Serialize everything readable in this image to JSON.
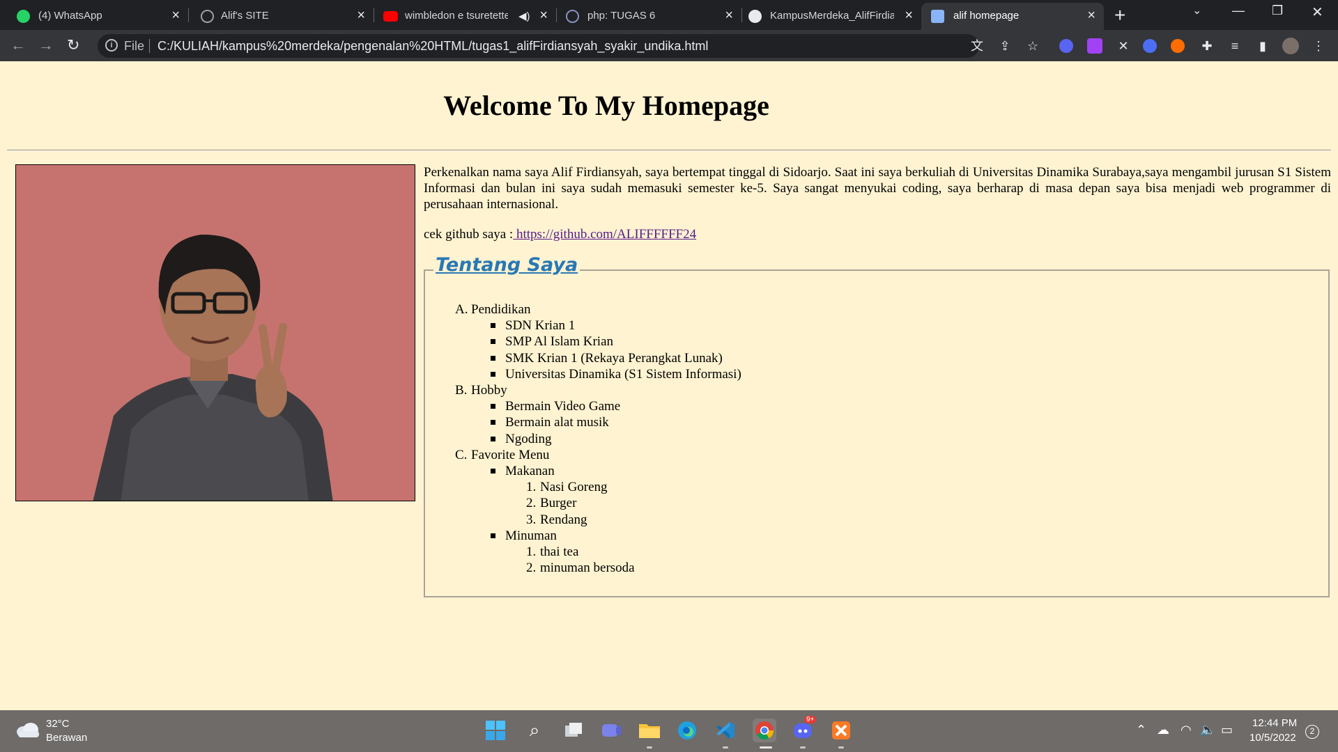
{
  "browser": {
    "tabs": [
      {
        "title": "(4) WhatsApp",
        "icon": "whatsapp-icon",
        "color": "#25d366"
      },
      {
        "title": "Alif's SITE",
        "icon": "globe-icon",
        "color": "#9aa0a6"
      },
      {
        "title": "wimbledon e tsuretette",
        "icon": "youtube-icon",
        "color": "#ff0000"
      },
      {
        "title": "php: TUGAS 6",
        "icon": "php-icon",
        "color": "#8892bf"
      },
      {
        "title": "KampusMerdeka_AlifFirdia",
        "icon": "github-icon",
        "color": "#e8eaed"
      },
      {
        "title": "alif homepage",
        "icon": "page-icon",
        "color": "#8ab4f8"
      }
    ],
    "address": {
      "scheme": "File",
      "url": "C:/KULIAH/kampus%20merdeka/pengenalan%20HTML/tugas1_alifFirdiansyah_syakir_undika.html"
    }
  },
  "page": {
    "heading": "Welcome To My Homepage",
    "intro": "Perkenalkan nama saya Alif Firdiansyah, saya bertempat tinggal di Sidoarjo. Saat ini saya berkuliah di Universitas Dinamika Surabaya,saya mengambil jurusan S1 Sistem Informasi dan bulan ini saya sudah memasuki semester ke-5. Saya sangat menyukai coding, saya berharap di masa depan saya bisa menjadi web programmer di perusahaan internasional.",
    "github_prefix": "cek github saya :",
    "github_link": " https://github.com/ALIFFFFFF24",
    "about_title": "Tentang Saya",
    "sections": [
      {
        "marker": "A.",
        "label": "Pendidikan",
        "items": [
          "SDN Krian 1",
          "SMP Al Islam Krian",
          "SMK Krian 1 (Rekaya Perangkat Lunak)",
          "Universitas Dinamika (S1 Sistem Informasi)"
        ]
      },
      {
        "marker": "B.",
        "label": "Hobby",
        "items": [
          "Bermain Video Game",
          "Bermain alat musik",
          "Ngoding"
        ]
      },
      {
        "marker": "C.",
        "label": "Favorite Menu",
        "groups": [
          {
            "label": "Makanan",
            "items": [
              {
                "marker": "1.",
                "text": "Nasi Goreng"
              },
              {
                "marker": "2.",
                "text": "Burger"
              },
              {
                "marker": "3.",
                "text": "Rendang"
              }
            ]
          },
          {
            "label": "Minuman",
            "items": [
              {
                "marker": "1.",
                "text": "thai tea"
              },
              {
                "marker": "2.",
                "text": "minuman bersoda"
              }
            ]
          }
        ]
      }
    ]
  },
  "taskbar": {
    "weather_temp": "32°C",
    "weather_desc": "Berawan",
    "time": "12:44 PM",
    "date": "10/5/2022",
    "notifications": "2",
    "discord_badge": "9+"
  }
}
